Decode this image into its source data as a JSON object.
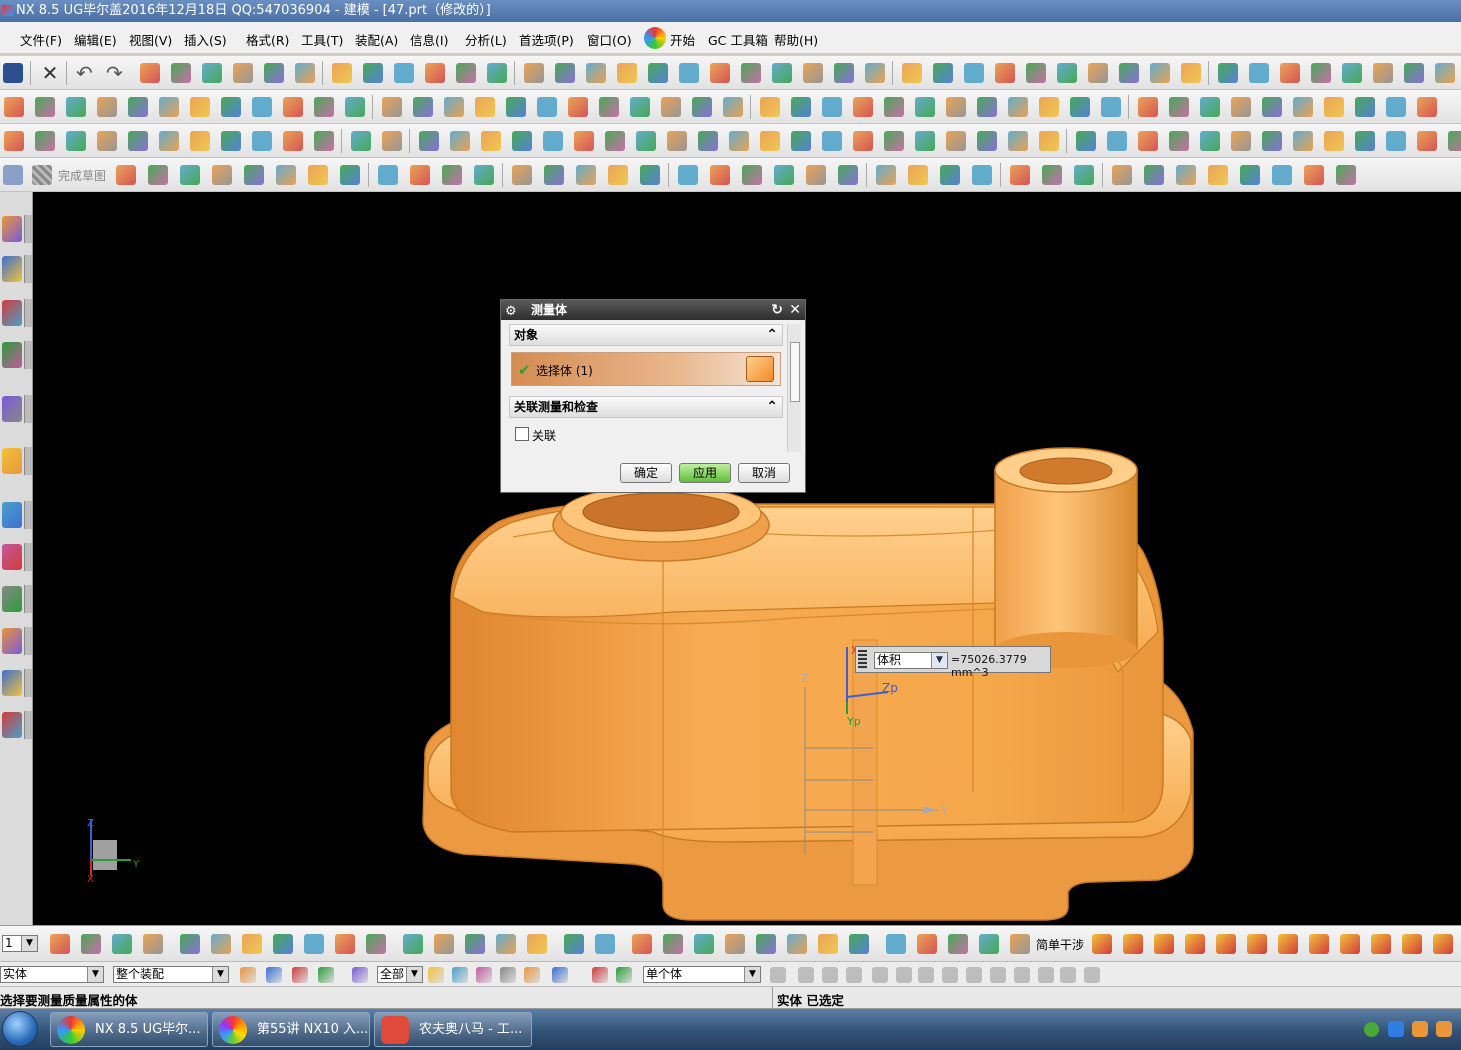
{
  "window": {
    "title": "NX 8.5 UG毕尔盖2016年12月18日 QQ:547036904 - 建模 - [47.prt（修改的）]"
  },
  "menu": [
    {
      "label": "文件(F)"
    },
    {
      "label": "编辑(E)"
    },
    {
      "label": "视图(V)"
    },
    {
      "label": "插入(S)"
    },
    {
      "label": "格式(R)"
    },
    {
      "label": "工具(T)"
    },
    {
      "label": "装配(A)"
    },
    {
      "label": "信息(I)"
    },
    {
      "label": "分析(L)"
    },
    {
      "label": "首选项(P)"
    },
    {
      "label": "窗口(O)"
    },
    {
      "label": "开始"
    },
    {
      "label": "GC 工具箱"
    },
    {
      "label": "帮助(H)"
    }
  ],
  "sketch_toolbar": {
    "finish_sketch": "完成草图"
  },
  "dialog": {
    "title": "测量体",
    "section_object": "对象",
    "select_body": "选择体 (1)",
    "section_assoc": "关联测量和检查",
    "assoc_label": "关联",
    "ok": "确定",
    "apply": "应用",
    "cancel": "取消"
  },
  "measure": {
    "type": "体积",
    "value": "=75026.3779 mm^3"
  },
  "axes": {
    "z": "Z",
    "y": "Y",
    "x": "X",
    "zp": "Zp",
    "yp": "Yp",
    "xp": "Xp"
  },
  "bottom_toolbar": {
    "simple_interference": "简单干涉",
    "layer_value": "1"
  },
  "selection_bar": {
    "filter": "实体",
    "scope": "整个装配",
    "all": "全部",
    "single": "单个体"
  },
  "status": {
    "prompt": "选择要测量质量属性的体",
    "right": "实体  已选定"
  },
  "taskbar": [
    {
      "label": "NX 8.5 UG毕尔..."
    },
    {
      "label": "第55讲 NX10 入..."
    },
    {
      "label": "农夫奥八马 - 工..."
    }
  ],
  "colors": {
    "model": "#f5a84a",
    "model_edge": "#c97a22",
    "background": "#000000",
    "accent_green": "#4aa83a"
  }
}
